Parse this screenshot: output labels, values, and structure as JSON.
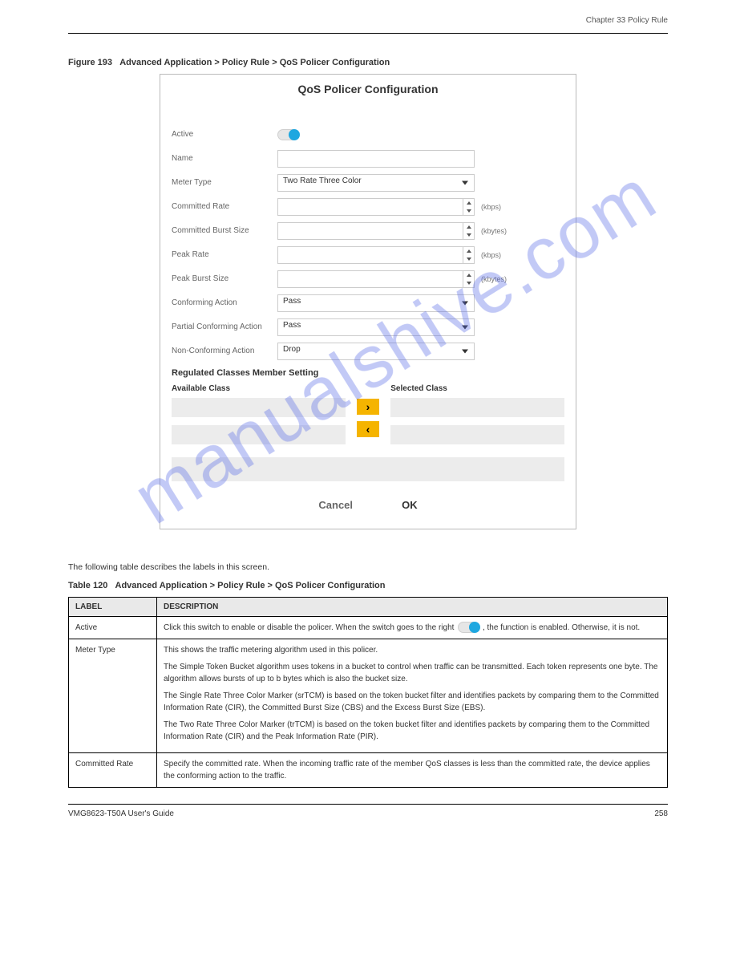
{
  "header": {
    "chapter": "Chapter 33 Policy Rule",
    "section": ""
  },
  "figure": {
    "num": "Figure 193",
    "title": "Advanced Application > Policy Rule > QoS Policer Configuration"
  },
  "panel": {
    "title": "QoS Policer Configuration",
    "labels": {
      "active": "Active",
      "name": "Name",
      "meter_type": "Meter Type",
      "committed_rate": "Committed Rate",
      "committed_burst": "Committed Burst Size",
      "peak_rate": "Peak Rate",
      "peak_burst": "Peak Burst Size",
      "conforming": "Conforming Action",
      "partial_conforming": "Partial Conforming Action",
      "non_conforming": "Non-Conforming Action"
    },
    "values": {
      "meter_type": "Two Rate Three Color",
      "conforming": "Pass",
      "partial_conforming": "Pass",
      "non_conforming": "Drop"
    },
    "units": {
      "kbps": "(kbps)",
      "kbytes": "(kbytes)"
    },
    "section": "Regulated Classes Member Setting",
    "available": "Available Class",
    "selected": "Selected Class",
    "cancel": "Cancel",
    "ok": "OK"
  },
  "body_text": "The following table describes the labels in this screen.",
  "table_caption": {
    "num": "Table 120",
    "title": "Advanced Application > Policy Rule > QoS Policer Configuration"
  },
  "table": {
    "headers": {
      "label": "LABEL",
      "desc": "DESCRIPTION"
    },
    "rows": [
      {
        "label": "Active",
        "desc_parts": {
          "a": "Click this switch to enable or disable the policer. When the switch goes to the right ",
          "b": ", the function is enabled. Otherwise, it is not."
        }
      },
      {
        "label": "Meter Type",
        "desc_parts": {
          "a": "This shows the traffic metering algorithm used in this policer.",
          "b": "The Simple Token Bucket algorithm uses tokens in a bucket to control when traffic can be transmitted. Each token represents one byte. The algorithm allows bursts of up to b bytes which is also the bucket size.",
          "c": "The Single Rate Three Color Marker (srTCM) is based on the token bucket filter and identifies packets by comparing them to the Committed Information Rate (CIR), the Committed Burst Size (CBS) and the Excess Burst Size (EBS).",
          "d": "The Two Rate Three Color Marker (trTCM) is based on the token bucket filter and identifies packets by comparing them to the Committed Information Rate (CIR) and the Peak Information Rate (PIR)."
        }
      },
      {
        "label": "Committed Rate",
        "desc_parts": {
          "a": "Specify the committed rate. When the incoming traffic rate of the member QoS classes is less than the committed rate, the device applies the conforming action to the traffic."
        }
      }
    ]
  },
  "footer": {
    "guide": "VMG8623-T50A User's Guide",
    "page": "258"
  },
  "watermark": "manualshive.com"
}
